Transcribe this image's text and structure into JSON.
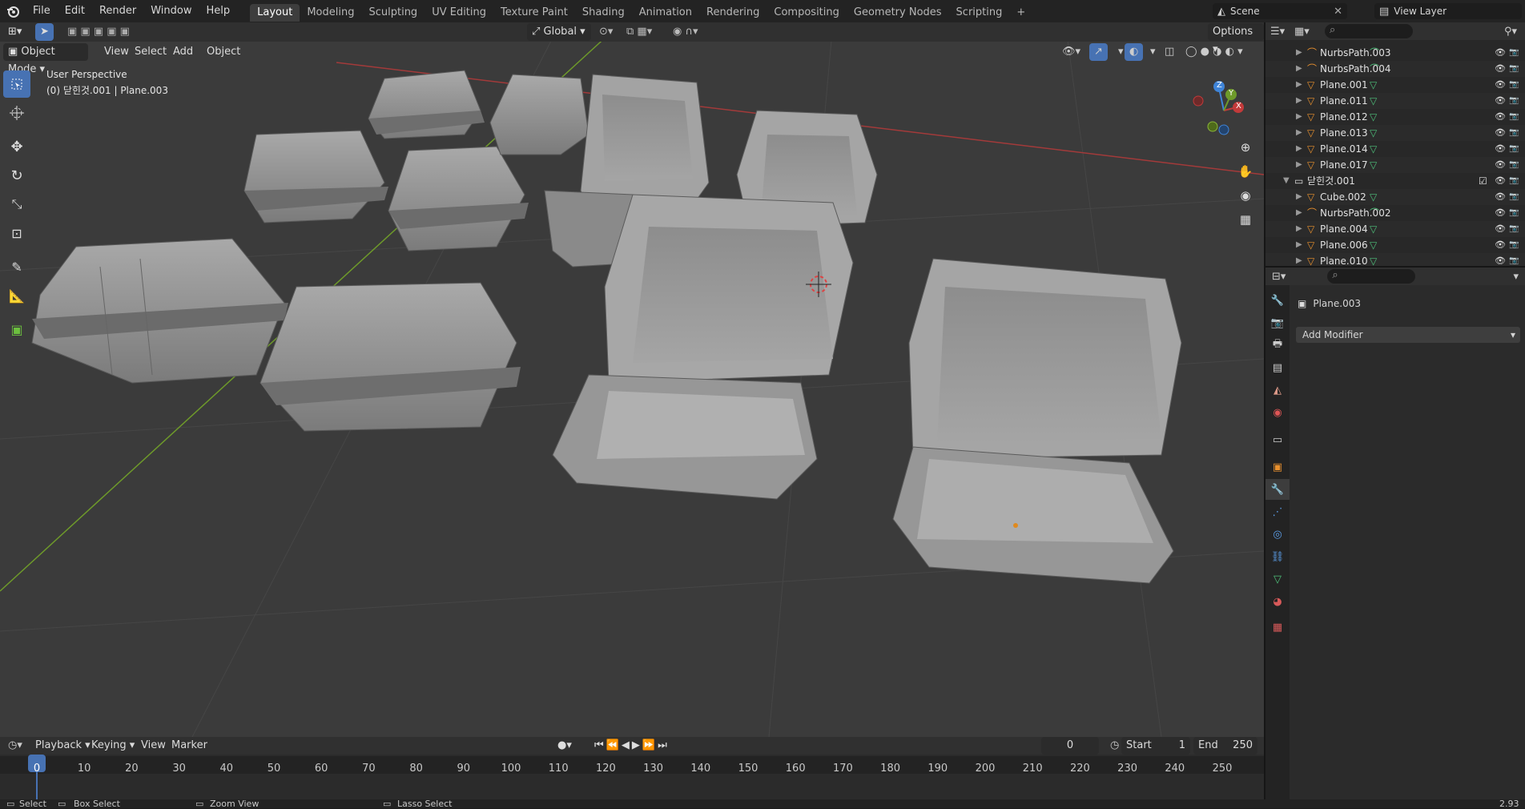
{
  "menubar": {
    "menus": [
      "File",
      "Edit",
      "Render",
      "Window",
      "Help"
    ],
    "workspaces": [
      "Layout",
      "Modeling",
      "Sculpting",
      "UV Editing",
      "Texture Paint",
      "Shading",
      "Animation",
      "Rendering",
      "Compositing",
      "Geometry Nodes",
      "Scripting"
    ],
    "active_workspace": "Layout",
    "scene": "Scene",
    "view_layer": "View Layer"
  },
  "viewport": {
    "mode": "Object Mode",
    "menus": [
      "View",
      "Select",
      "Add",
      "Object"
    ],
    "transform_orientation": "Global",
    "options_label": "Options",
    "overlay_title": "User Perspective",
    "overlay_subtitle": "(0) 닫힌것.001 | Plane.003",
    "gizmo_axes": {
      "x": "X",
      "y": "Y",
      "z": "Z"
    }
  },
  "outliner": {
    "rows": [
      {
        "label": "NurbsPath.003",
        "icon": "curve-icon",
        "indent": 2
      },
      {
        "label": "NurbsPath.004",
        "icon": "curve-icon",
        "indent": 2
      },
      {
        "label": "Plane.001",
        "icon": "mesh-icon",
        "indent": 2
      },
      {
        "label": "Plane.011",
        "icon": "mesh-icon",
        "indent": 2
      },
      {
        "label": "Plane.012",
        "icon": "mesh-icon",
        "indent": 2
      },
      {
        "label": "Plane.013",
        "icon": "mesh-icon",
        "indent": 2
      },
      {
        "label": "Plane.014",
        "icon": "mesh-icon",
        "indent": 2
      },
      {
        "label": "Plane.017",
        "icon": "mesh-icon",
        "indent": 2
      },
      {
        "label": "닫힌것.001",
        "icon": "collection-icon",
        "indent": 1
      },
      {
        "label": "Cube.002",
        "icon": "mesh-icon",
        "indent": 2
      },
      {
        "label": "NurbsPath.002",
        "icon": "curve-icon",
        "indent": 2
      },
      {
        "label": "Plane.004",
        "icon": "mesh-icon",
        "indent": 2
      },
      {
        "label": "Plane.006",
        "icon": "mesh-icon",
        "indent": 2
      },
      {
        "label": "Plane.010",
        "icon": "mesh-icon",
        "indent": 2
      }
    ]
  },
  "properties": {
    "object_name": "Plane.003",
    "add_modifier_label": "Add Modifier"
  },
  "timeline": {
    "menus": [
      "Playback",
      "Keying",
      "View",
      "Marker"
    ],
    "current_frame": "0",
    "start_label": "Start",
    "start_value": "1",
    "end_label": "End",
    "end_value": "250",
    "ticks": [
      "0",
      "10",
      "20",
      "30",
      "40",
      "50",
      "60",
      "70",
      "80",
      "90",
      "100",
      "110",
      "120",
      "130",
      "140",
      "150",
      "160",
      "170",
      "180",
      "190",
      "200",
      "210",
      "220",
      "230",
      "240",
      "250"
    ]
  },
  "statusbar": {
    "items": [
      "Select",
      "Box Select",
      "Zoom View",
      "Lasso Select"
    ],
    "version": "2.93"
  },
  "colors": {
    "accent": "#4772b3",
    "x_axis": "#c23a3a",
    "y_axis": "#6e9a2a",
    "z_axis": "#3f84d8"
  }
}
